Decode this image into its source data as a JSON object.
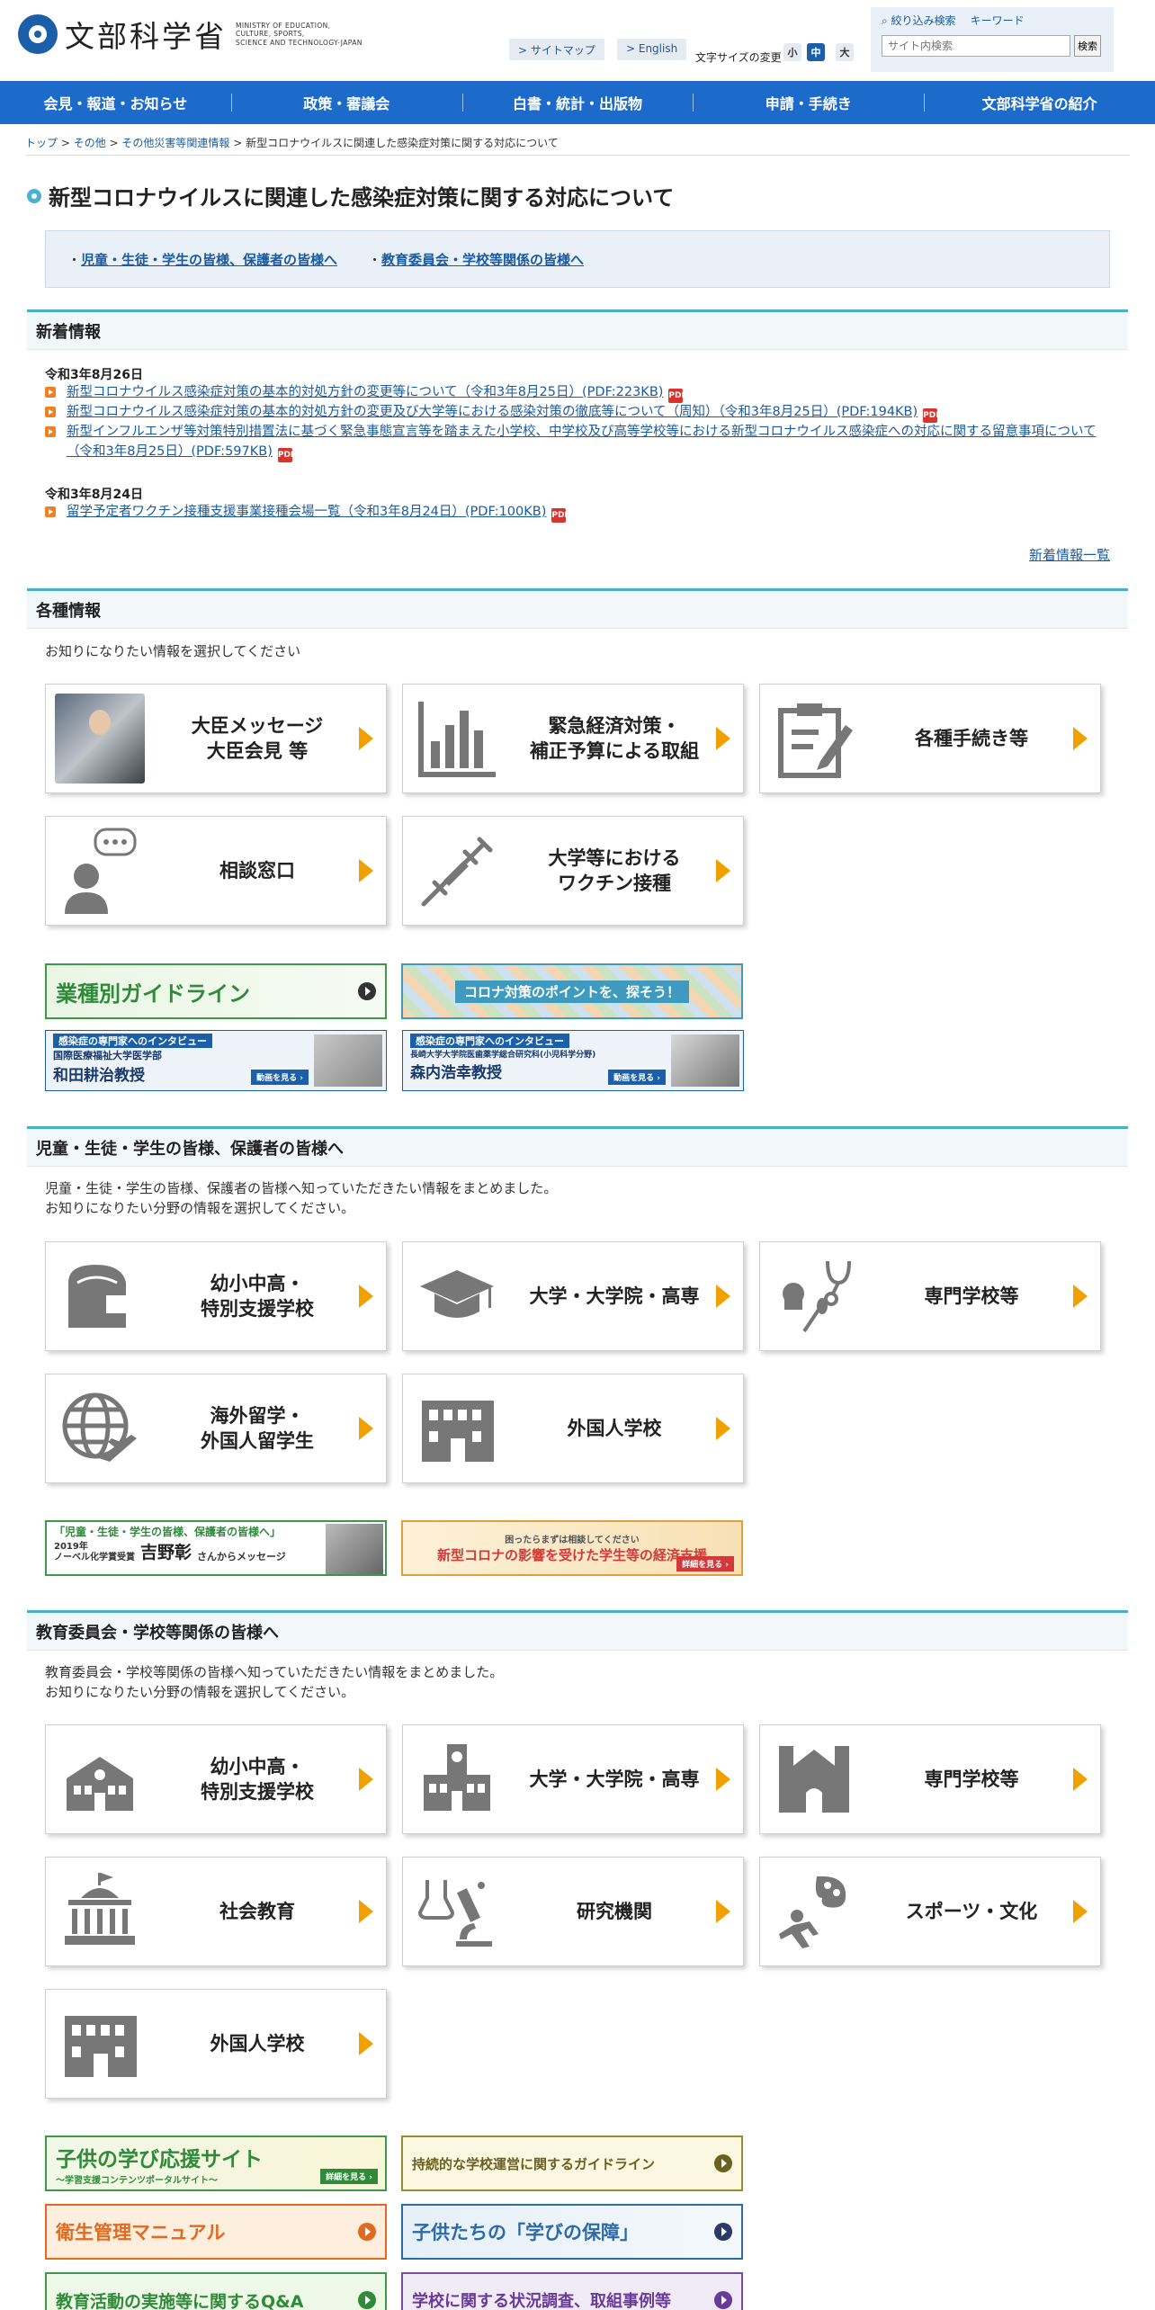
{
  "header": {
    "logo_jp": "文部科学省",
    "logo_en": [
      "MINISTRY OF EDUCATION,",
      "CULTURE, SPORTS,",
      "SCIENCE AND TECHNOLOGY-JAPAN"
    ],
    "sitemap": "> サイトマップ",
    "english": "> English",
    "font_size_label": "文字サイズの変更",
    "font_sizes": [
      "小",
      "中",
      "大"
    ],
    "search_tab_filter": "絞り込み検索",
    "search_tab_keyword": "キーワード",
    "search_placeholder": "サイト内検索",
    "search_button": "検索"
  },
  "nav": [
    "会見・報道・お知らせ",
    "政策・審議会",
    "白書・統計・出版物",
    "申請・手続き",
    "文部科学省の紹介"
  ],
  "breadcrumb": [
    "トップ",
    "その他",
    "その他災害等関連情報",
    "新型コロナウイルスに関連した感染症対策に関する対応について"
  ],
  "title": "新型コロナウイルスに関連した感染症対策に関する対応について",
  "anchors": [
    "児童・生徒・学生の皆様、保護者の皆様へ",
    "教育委員会・学校等関係の皆様へ"
  ],
  "news": {
    "heading": "新着情報",
    "date1": "令和3年8月26日",
    "item1": "新型コロナウイルス感染症対策の基本的対処方針の変更等について（令和3年8月25日）(PDF:223KB)",
    "item2": "新型コロナウイルス感染症対策の基本的対処方針の変更及び大学等における感染対策の徹底等について（周知）（令和3年8月25日）(PDF:194KB)",
    "item3": "新型インフルエンザ等対策特別措置法に基づく緊急事態宣言等を踏まえた小学校、中学校及び高等学校等における新型コロナウイルス感染症への対応に関する留意事項について（令和3年8月25日）(PDF:597KB)",
    "date2": "令和3年8月24日",
    "item4": "留学予定者ワクチン接種支援事業接種会場一覧（令和3年8月24日）(PDF:100KB)",
    "more": "新着情報一覧",
    "pdf": "PDF"
  },
  "general": {
    "heading": "各種情報",
    "intro": "お知りになりたい情報を選択してください",
    "cards": [
      "大臣メッセージ\n大臣会見 等",
      "緊急経済対策・\n補正予算による取組",
      "各種手続き等",
      "相談窓口",
      "大学等における\nワクチン接種"
    ],
    "banner_guideline": "業種別ガイドライン",
    "banner_points": "コロナ対策のポイントを、探そう！",
    "interview_head": "感染症の専門家へのインタビュー",
    "interview1_org": "国際医療福祉大学医学部",
    "interview1_name": "和田耕治教授",
    "interview2_org": "長崎大学大学院医歯薬学総合研究科(小児科学分野)",
    "interview2_name": "森内浩幸教授",
    "see_video": "動画を見る ›"
  },
  "students": {
    "heading": "児童・生徒・学生の皆様、保護者の皆様へ",
    "intro1": "児童・生徒・学生の皆様、保護者の皆様へ知っていただきたい情報をまとめました。",
    "intro2": "お知りになりたい分野の情報を選択してください。",
    "cards": [
      "幼小中高・\n特別支援学校",
      "大学・大学院・高専",
      "専門学校等",
      "海外留学・\n外国人留学生",
      "外国人学校"
    ],
    "banner1_head": "「児童・生徒・学生の皆様、保護者の皆様へ」",
    "banner1_sub": "2019年\nノーベル化学賞受賞",
    "banner1_name": "吉野彰",
    "banner1_tail": "さんからメッセージ",
    "banner2_head": "困ったらまずは相談してください",
    "banner2_main": "新型コロナの影響を受けた学生等の経済支援",
    "banner2_tag": "詳細を見る ›"
  },
  "boards": {
    "heading": "教育委員会・学校等関係の皆様へ",
    "intro1": "教育委員会・学校等関係の皆様へ知っていただきたい情報をまとめました。",
    "intro2": "お知りになりたい分野の情報を選択してください。",
    "cards": [
      "幼小中高・\n特別支援学校",
      "大学・大学院・高専",
      "専門学校等",
      "社会教育",
      "研究機関",
      "スポーツ・文化",
      "外国人学校"
    ],
    "banners": [
      "子供の学び応援サイト",
      "持続的な学校運営に関するガイドライン",
      "衛生管理マニュアル",
      "子供たちの「学びの保障」",
      "教育活動の実施等に関するQ&A",
      "学校に関する状況調査、取組事例等"
    ],
    "banner1_sub": "～学習支援コンテンツポータルサイト～",
    "banner1_tag": "詳細を見る ›"
  },
  "colors": {
    "nav": "#1c6bcb",
    "accent": "#4ab0c5",
    "arrow": "#f0a100",
    "link": "#1a5a9e"
  }
}
